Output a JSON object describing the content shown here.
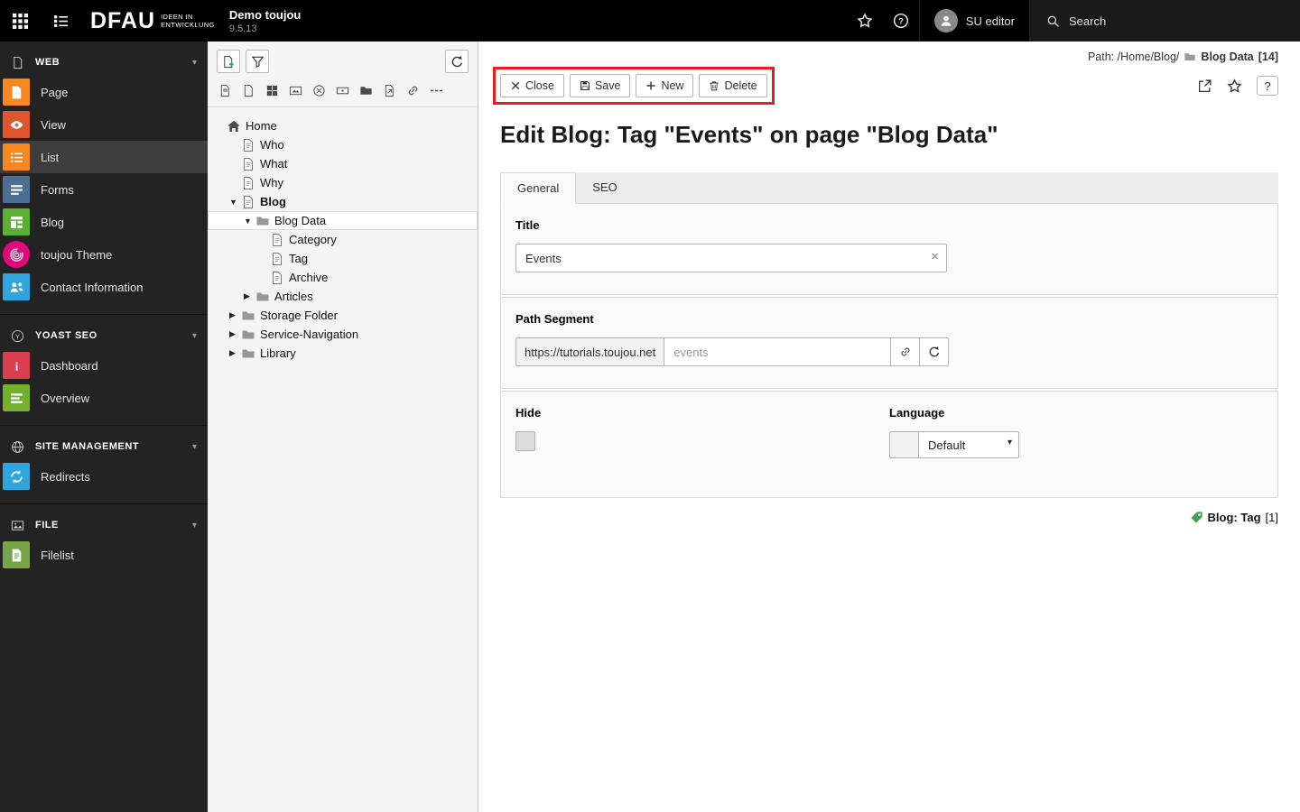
{
  "colors": {
    "annotation_red": "#e81c1c",
    "module_page": "#f7871f",
    "module_view": "#e0552e",
    "module_list": "#f7871f",
    "module_forms": "#4d6f94",
    "module_blog": "#5cb031",
    "module_theme": "#e5067d",
    "module_contact": "#30a4dc",
    "module_dashboard": "#dc3d4e",
    "module_overview": "#74b02c",
    "module_redirects": "#30a4dc",
    "module_filelist": "#79a548",
    "tag_green": "#3fa44e"
  },
  "icons": {
    "modulemenu": "3x3-grid",
    "navigation_toggle": "list-tree",
    "star": "star-outline",
    "help": "question-mark-circle",
    "user": "person",
    "search": "magnifier",
    "new_page": "page-plus",
    "filter": "funnel",
    "refresh": "circular-arrow",
    "close": "x",
    "save": "floppy-disk",
    "new": "plus",
    "delete": "trash-can",
    "open_in_new": "window-arrow",
    "clear": "x",
    "link": "chain",
    "tag": "pricetag",
    "folder": "folder"
  },
  "topbar": {
    "brand": "DFAU",
    "brand_claim_line1": "IDEEN IN",
    "brand_claim_line2": "ENTWICKLUNG",
    "site_title": "Demo toujou",
    "version": "9.5.13",
    "username": "SU editor",
    "search_label": "Search"
  },
  "sidebar": {
    "sections": [
      {
        "label": "WEB",
        "items": [
          {
            "label": "Page"
          },
          {
            "label": "View"
          },
          {
            "label": "List"
          },
          {
            "label": "Forms"
          },
          {
            "label": "Blog"
          },
          {
            "label": "toujou Theme"
          },
          {
            "label": "Contact Information"
          }
        ]
      },
      {
        "label": "YOAST SEO",
        "items": [
          {
            "label": "Dashboard"
          },
          {
            "label": "Overview"
          }
        ]
      },
      {
        "label": "SITE MANAGEMENT",
        "items": [
          {
            "label": "Redirects"
          }
        ]
      },
      {
        "label": "FILE",
        "items": [
          {
            "label": "Filelist"
          }
        ]
      }
    ]
  },
  "pagetree": {
    "nodes": [
      {
        "label": "Home"
      },
      {
        "label": "Who"
      },
      {
        "label": "What"
      },
      {
        "label": "Why"
      },
      {
        "label": "Blog"
      },
      {
        "label": "Blog Data"
      },
      {
        "label": "Category"
      },
      {
        "label": "Tag"
      },
      {
        "label": "Archive"
      },
      {
        "label": "Articles"
      },
      {
        "label": "Storage Folder"
      },
      {
        "label": "Service-Navigation"
      },
      {
        "label": "Library"
      }
    ]
  },
  "main": {
    "path_prefix": "Path: /Home/Blog/",
    "path_current": "Blog Data",
    "path_count": "[14]",
    "buttons": {
      "close": "Close",
      "save": "Save",
      "new": "New",
      "delete": "Delete"
    },
    "title": "Edit Blog: Tag \"Events\" on page \"Blog Data\"",
    "tabs": {
      "general": "General",
      "seo": "SEO"
    },
    "form": {
      "title_label": "Title",
      "title_value": "Events",
      "path_segment_label": "Path Segment",
      "path_segment_prefix": "https://tutorials.toujou.net",
      "path_segment_placeholder": "events",
      "hide_label": "Hide",
      "language_label": "Language",
      "language_value": "Default"
    },
    "footer": {
      "ref_label": "Blog: Tag",
      "ref_count": "[1]"
    }
  }
}
